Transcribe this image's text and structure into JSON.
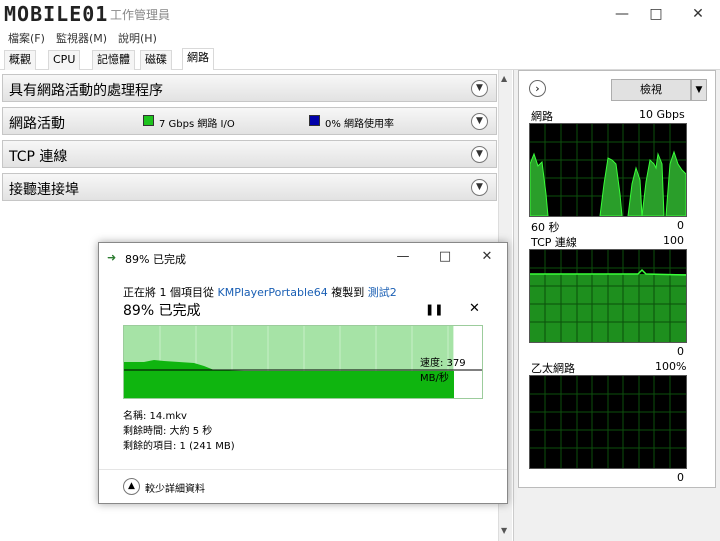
{
  "window": {
    "title": "工作管理員",
    "logo_text": "MOBILE01"
  },
  "menu": [
    "檔案(F)",
    "監視器(M)",
    "說明(H)"
  ],
  "tabs": [
    "概觀",
    "CPU",
    "記憶體",
    "磁碟",
    "網路"
  ],
  "active_tab": "網路",
  "sections": [
    {
      "title": "具有網路活動的處理程序"
    },
    {
      "title": "網路活動",
      "legend": [
        {
          "color": "#1ec31e",
          "text": "7 Gbps 網路 I/O"
        },
        {
          "color": "#0000aa",
          "text": "0% 網路使用率"
        }
      ]
    },
    {
      "title": "TCP 連線"
    },
    {
      "title": "接聽連接埠"
    }
  ],
  "right_panel": {
    "view_button": "檢視",
    "graphs": [
      {
        "name": "網路",
        "max": "10 Gbps",
        "time": "60 秒",
        "min": "0"
      },
      {
        "name": "TCP 連線",
        "max": "100",
        "min": "0"
      },
      {
        "name": "乙太網路",
        "max": "100%",
        "min": "0"
      }
    ]
  },
  "dialog": {
    "title": "89% 已完成",
    "line_prefix": "正在將 1 個項目從 ",
    "source": "KMPlayerPortable64",
    "line_mid": " 複製到 ",
    "dest": "測試2",
    "percent_text": "89% 已完成",
    "progress": 0.92,
    "speed": "速度: 379 MB/秒",
    "name": "名稱: 14.mkv",
    "time_left": "剩餘時間: 大約 5 秒",
    "items_left": "剩餘的項目: 1 (241 MB)",
    "more_details": "較少詳細資料"
  }
}
